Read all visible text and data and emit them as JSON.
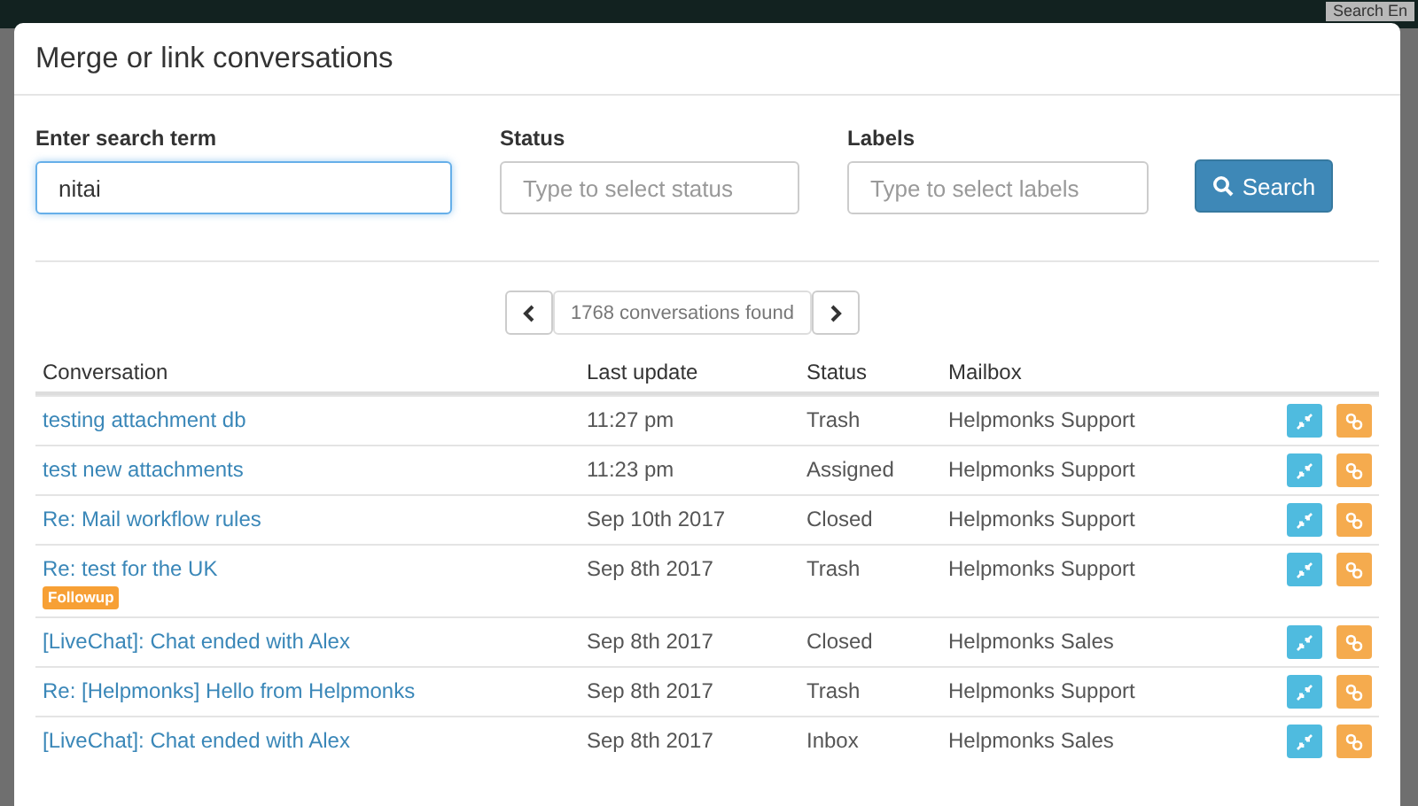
{
  "backdrop": {
    "search_field_value": "Search En"
  },
  "dialog": {
    "title": "Merge or link conversations",
    "filters": [
      {
        "label": "Enter search term",
        "value": "nitai",
        "focused": true
      },
      {
        "label": "Status",
        "placeholder": "Type to select status",
        "focused": false
      },
      {
        "label": "Labels",
        "placeholder": "Type to select labels",
        "focused": false
      }
    ],
    "search_button": "Search",
    "pager": {
      "count": "1768 conversations found"
    },
    "table": {
      "columns": [
        "Conversation",
        "Last update",
        "Status",
        "Mailbox"
      ],
      "rows": [
        {
          "conversation": "testing attachment db",
          "last_update": "11:27 pm",
          "status": "Trash",
          "mailbox": "Helpmonks Support",
          "tags": []
        },
        {
          "conversation": "test new attachments",
          "last_update": "11:23 pm",
          "status": "Assigned",
          "mailbox": "Helpmonks Support",
          "tags": []
        },
        {
          "conversation": "Re: Mail workflow rules",
          "last_update": "Sep 10th 2017",
          "status": "Closed",
          "mailbox": "Helpmonks Support",
          "tags": []
        },
        {
          "conversation": "Re: test for the UK",
          "last_update": "Sep 8th 2017",
          "status": "Trash",
          "mailbox": "Helpmonks Support",
          "tags": [
            "Followup"
          ]
        },
        {
          "conversation": "[LiveChat]: Chat ended with Alex",
          "last_update": "Sep 8th 2017",
          "status": "Closed",
          "mailbox": "Helpmonks Sales",
          "tags": []
        },
        {
          "conversation": "Re: [Helpmonks] Hello from Helpmonks",
          "last_update": "Sep 8th 2017",
          "status": "Trash",
          "mailbox": "Helpmonks Support",
          "tags": []
        },
        {
          "conversation": "[LiveChat]: Chat ended with Alex",
          "last_update": "Sep 8th 2017",
          "status": "Inbox",
          "mailbox": "Helpmonks Sales",
          "tags": []
        }
      ]
    }
  }
}
